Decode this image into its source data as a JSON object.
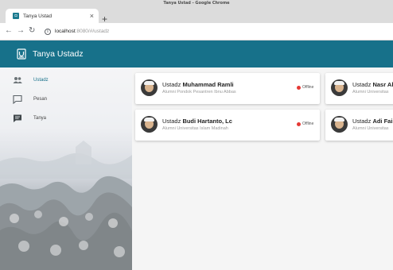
{
  "browser": {
    "window_title": "Tanya Ustad - Google Chrome",
    "tab_title": "Tanya Ustad",
    "tab_close": "×",
    "new_tab": "+",
    "url_host": "localhost",
    "url_rest": ":8080/#/ustadz"
  },
  "app": {
    "title": "Tanya Ustadz",
    "brand_color": "#17718a"
  },
  "sidebar": {
    "items": [
      {
        "label": "Ustadz",
        "icon": "people-icon",
        "active": true
      },
      {
        "label": "Pesan",
        "icon": "message-icon",
        "active": false
      },
      {
        "label": "Tanya",
        "icon": "chat-icon",
        "active": false
      }
    ]
  },
  "cards": [
    {
      "prefix": "Ustadz",
      "name": "Muhammad Ramli",
      "subtitle": "Alumni Pondok Pesantren Ibnu Abbas",
      "status": "Offline"
    },
    {
      "prefix": "Ustadz",
      "name": "Nasr Ab",
      "subtitle": "Alumni Universitas",
      "status": ""
    },
    {
      "prefix": "Ustadz",
      "name": "Budi Hartanto, Lc",
      "subtitle": "Alumni Universitas Islam Madinah",
      "status": "Offline"
    },
    {
      "prefix": "Ustadz",
      "name": "Adi Fais",
      "subtitle": "Alumni Universitas",
      "status": ""
    }
  ],
  "status_color": "#e53935"
}
